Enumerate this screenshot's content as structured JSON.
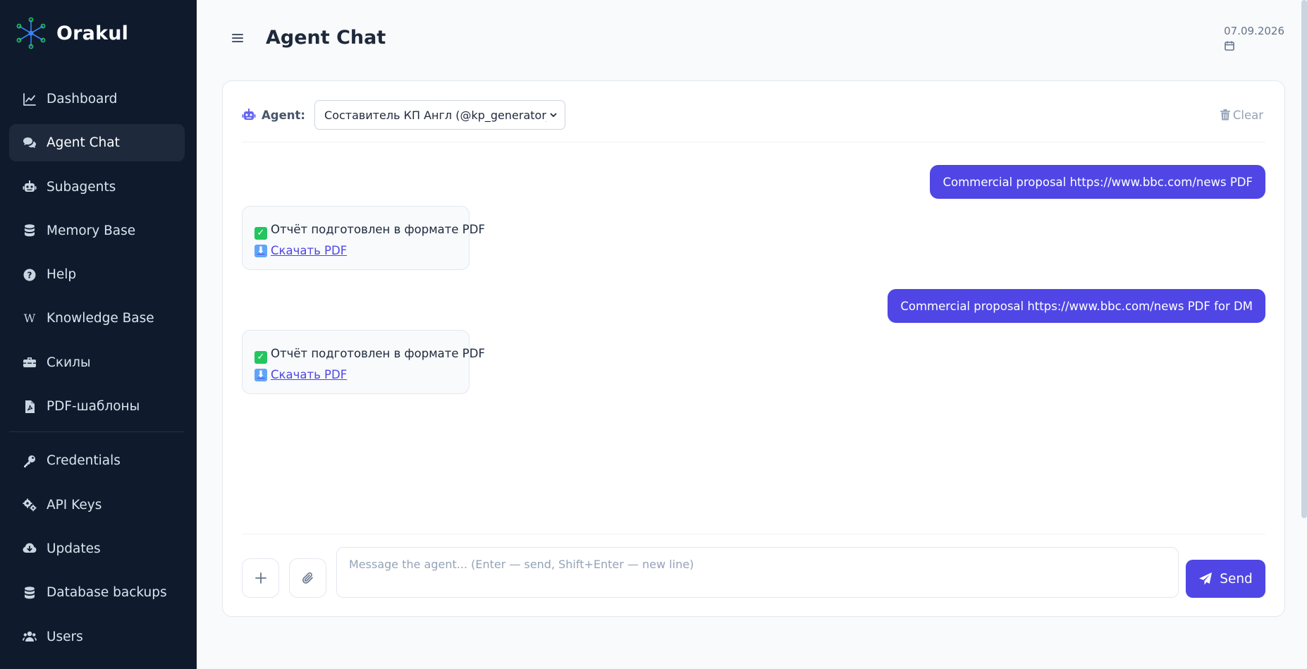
{
  "app": {
    "name": "Orakul"
  },
  "sidebar": {
    "items": [
      {
        "label": "Dashboard",
        "icon": "chart-line-icon",
        "active": false
      },
      {
        "label": "Agent Chat",
        "icon": "chat-bubbles-icon",
        "active": true
      },
      {
        "label": "Subagents",
        "icon": "robot-icon",
        "active": false
      },
      {
        "label": "Memory Base",
        "icon": "database-icon",
        "active": false
      },
      {
        "label": "Help",
        "icon": "question-circle-icon",
        "active": false
      },
      {
        "label": "Knowledge Base",
        "icon": "wikipedia-icon",
        "active": false
      },
      {
        "label": "Скилы",
        "icon": "toolbox-icon",
        "active": false
      },
      {
        "label": "PDF-шаблоны",
        "icon": "file-pdf-icon",
        "active": false
      }
    ],
    "items_bottom": [
      {
        "label": "Credentials",
        "icon": "key-icon"
      },
      {
        "label": "API Keys",
        "icon": "gears-icon"
      },
      {
        "label": "Updates",
        "icon": "cloud-download-icon"
      },
      {
        "label": "Database backups",
        "icon": "database-icon"
      },
      {
        "label": "Users",
        "icon": "users-icon"
      }
    ]
  },
  "header": {
    "title": "Agent Chat",
    "date": "07.09.2026"
  },
  "chat": {
    "agent_label": "Agent:",
    "agent_selected": "Составитель КП Англ (@kp_generator_en_r",
    "clear_label": "Clear",
    "messages": [
      {
        "role": "user",
        "text": "Commercial proposal https://www.bbc.com/news PDF"
      },
      {
        "role": "bot",
        "text": "Отчёт подготовлен в формате PDF",
        "link": "Скачать PDF"
      },
      {
        "role": "user",
        "text": "Commercial proposal https://www.bbc.com/news PDF for DM"
      },
      {
        "role": "bot",
        "text": "Отчёт подготовлен в формате PDF",
        "link": "Скачать PDF"
      }
    ],
    "input_placeholder": "Message the agent... (Enter — send, Shift+Enter — new line)",
    "input_value": "",
    "send_label": "Send"
  },
  "colors": {
    "sidebar_bg": "#0f1b2d",
    "accent": "#4f46e5",
    "success": "#22c55e"
  }
}
